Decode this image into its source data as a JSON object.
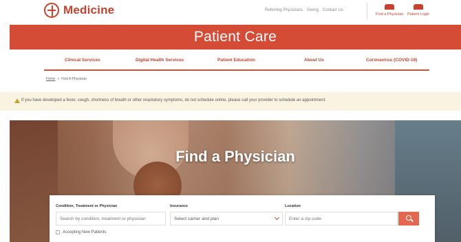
{
  "brand": {
    "name": "Medicine",
    "accent": "#c8412f",
    "banner_color": "#d44b36"
  },
  "utility_links": [
    "Referring Physicians",
    "Giving",
    "Contact Us"
  ],
  "header_actions": [
    {
      "label": "Find a Physician",
      "icon": "stethoscope-icon"
    },
    {
      "label": "Patient Login",
      "icon": "login-icon"
    }
  ],
  "banner": {
    "title": "Patient Care"
  },
  "nav": [
    "Clinical Services",
    "Digital Health Services",
    "Patient Education",
    "About Us",
    "Coronavirus (COVID-19)"
  ],
  "breadcrumb": {
    "home": "Home",
    "separator": ">",
    "current": "Find A Physician"
  },
  "alert": {
    "icon": "warning-icon",
    "text": "If you have developed a fever, cough, shortness of breath or other respiratory symptoms, do not schedule online, please call your provider to schedule an appointment."
  },
  "hero": {
    "title": "Find a Physician"
  },
  "search": {
    "condition_label": "Condition, Treatment or Physician",
    "condition_placeholder": "Search by condition, treatment or physician",
    "insurance_label": "Insurance",
    "insurance_value": "Select carrier and plan",
    "location_label": "Location",
    "location_placeholder": "Enter a zip code",
    "button_icon": "search-icon",
    "accepting_label": "Accepting New Patients"
  }
}
